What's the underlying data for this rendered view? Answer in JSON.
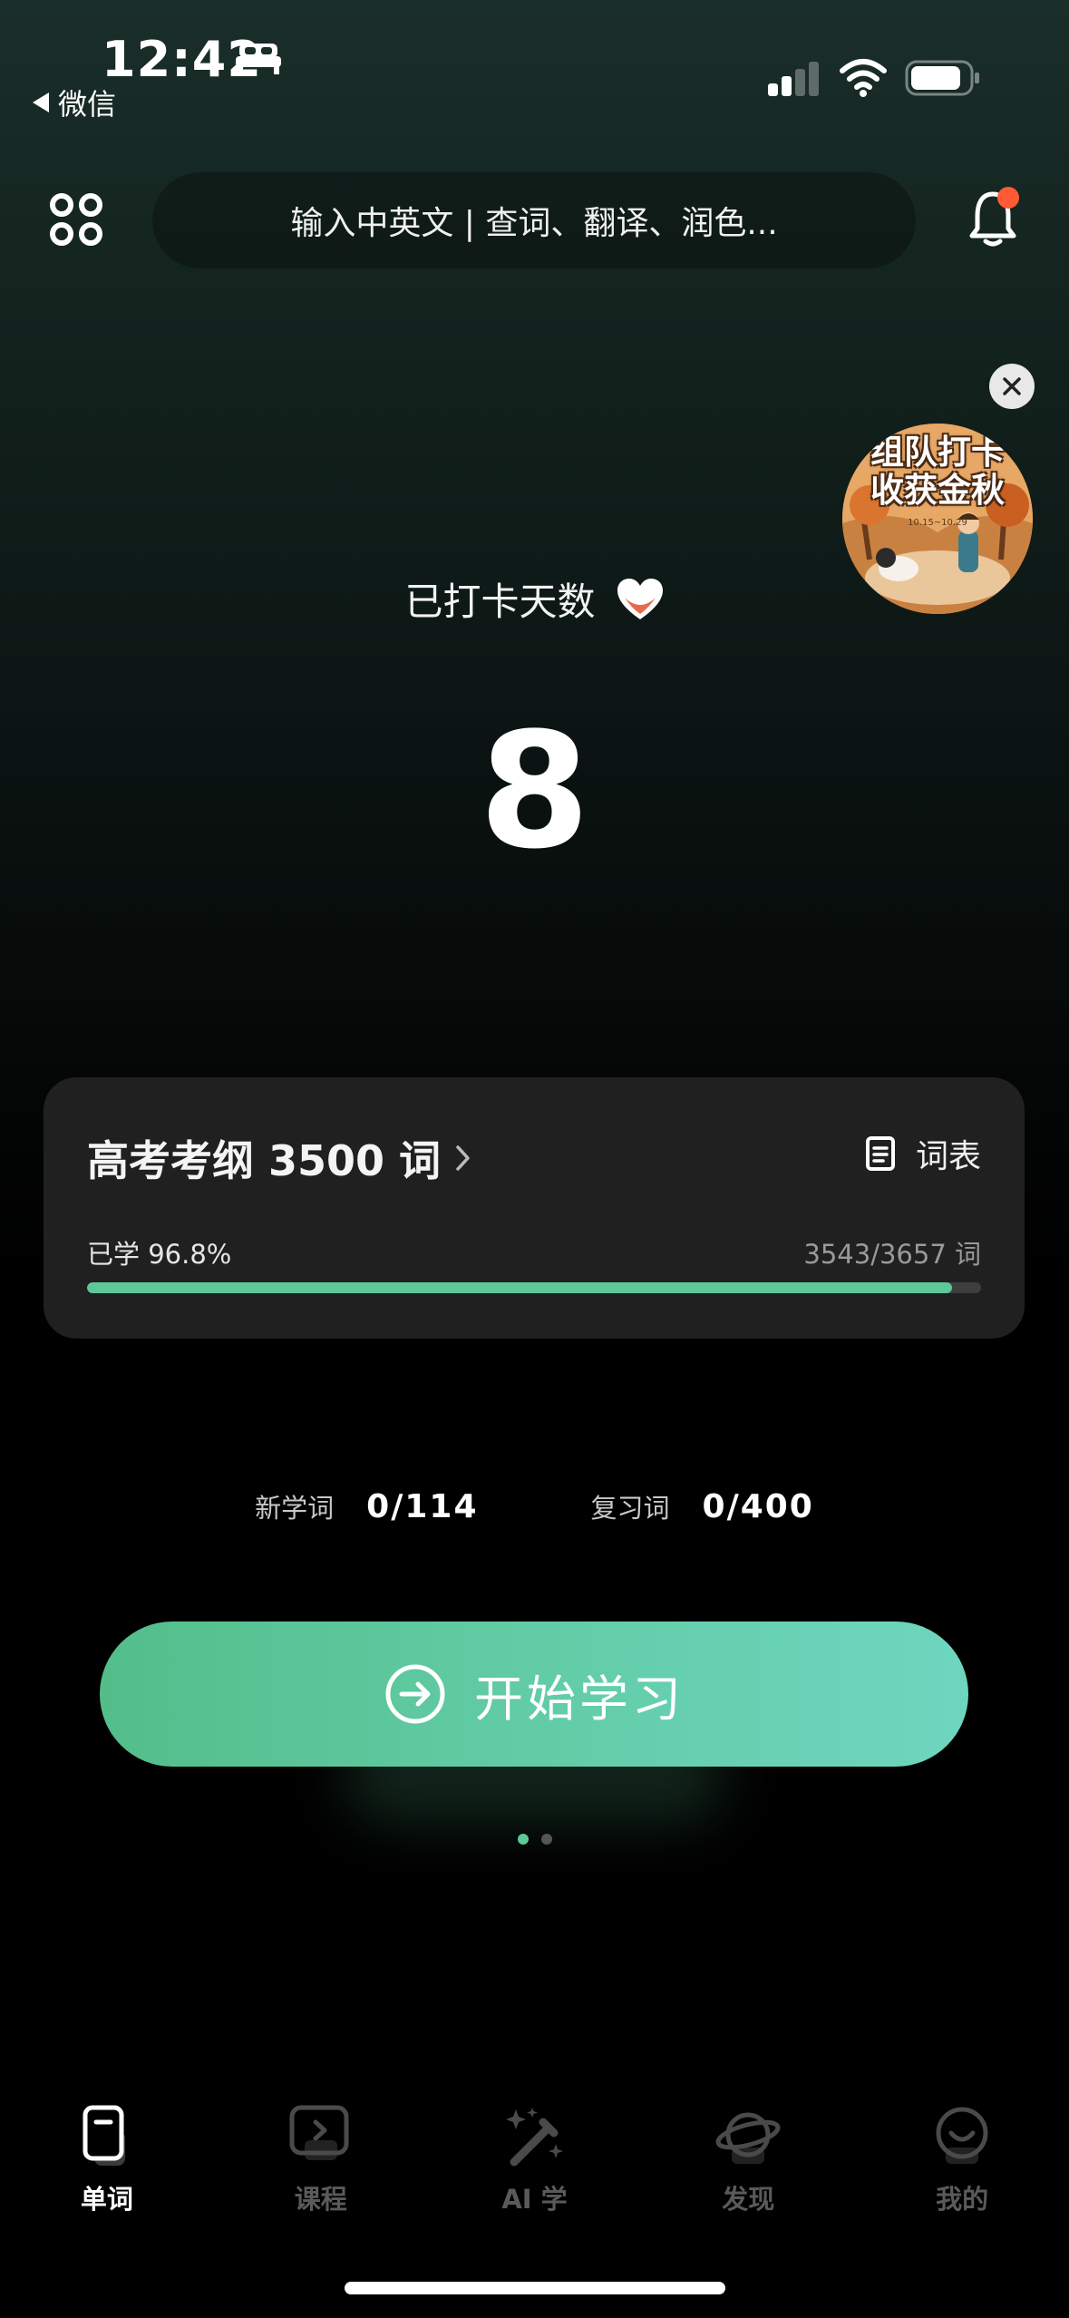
{
  "status_bar": {
    "time": "12:42",
    "back_label": "微信"
  },
  "search": {
    "placeholder": "输入中英文 | 查词、翻译、润色..."
  },
  "promo": {
    "line1": "组队打卡",
    "line2": "收获金秋",
    "date": "10.15~10.29"
  },
  "checkin": {
    "label": "已打卡天数",
    "count": "8"
  },
  "book": {
    "title": "高考考纲 3500 词",
    "wordlist_label": "词表",
    "progress_label": "已学 96.8%",
    "progress_count": "3543/3657 词",
    "progress_fraction": 0.968
  },
  "stats": {
    "new_label": "新学词",
    "new_value": "0/114",
    "review_label": "复习词",
    "review_value": "0/400"
  },
  "start_button_label": "开始学习",
  "pager": {
    "total": 2,
    "active": 0
  },
  "tabs": [
    {
      "label": "单词",
      "icon": "word-card-icon",
      "active": true
    },
    {
      "label": "课程",
      "icon": "course-play-icon",
      "active": false
    },
    {
      "label": "AI 学",
      "icon": "magic-wand-icon",
      "active": false
    },
    {
      "label": "发现",
      "icon": "planet-icon",
      "active": false
    },
    {
      "label": "我的",
      "icon": "smile-face-icon",
      "active": false
    }
  ],
  "colors": {
    "accent": "#5ec898",
    "badge": "#ff5a36"
  }
}
